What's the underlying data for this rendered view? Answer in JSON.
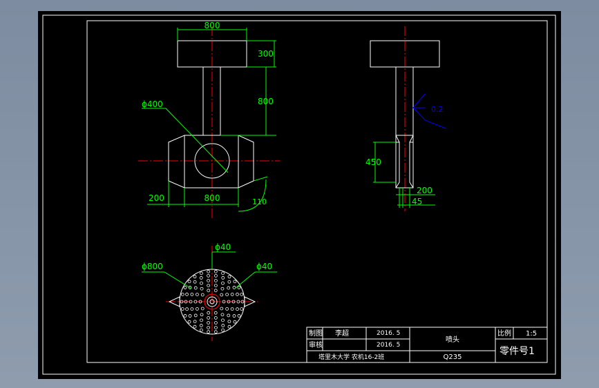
{
  "drawing": {
    "dimensions": {
      "head_width": "800",
      "head_height": "300",
      "stem_height": "800",
      "bore_dia": "ϕ400",
      "base_side": "200",
      "base_width": "800",
      "chamfer_angle": "110",
      "side_length": "450",
      "side_width": "200",
      "side_small": "45",
      "roughness": "0.2",
      "hole_small_top": "ϕ40",
      "disc_dia": "ϕ800",
      "hole_small_right": "ϕ40"
    },
    "title_block": {
      "drawn_label": "制图",
      "drawn_name": "李超",
      "drawn_date": "2016. 5",
      "check_label": "审核",
      "check_date": "2016. 5",
      "school": "塔里木大学  农机16-2班",
      "part_name": "喷头",
      "material": "Q235",
      "scale_label": "比例",
      "scale_value": "1:5",
      "part_no": "零件号1"
    },
    "colors": {
      "background": "#000000",
      "outline": "#ffffff",
      "dimension": "#00ff00",
      "centerline": "#ff0000",
      "roughness": "#0000ff"
    }
  }
}
